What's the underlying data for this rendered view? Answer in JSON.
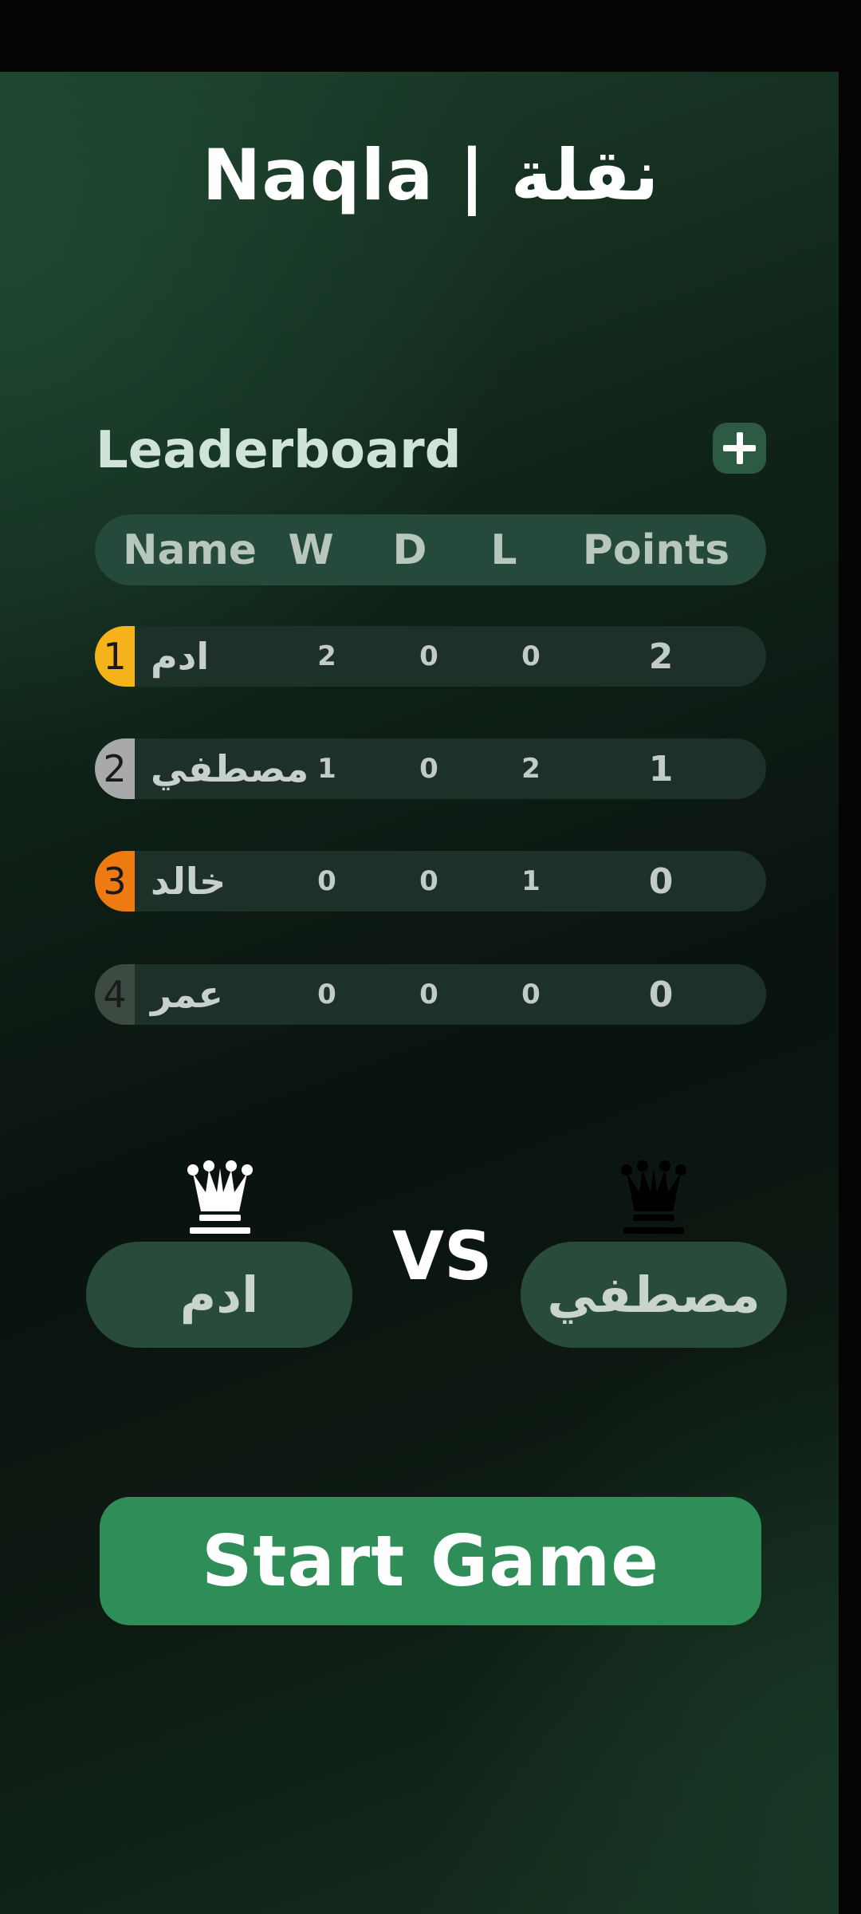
{
  "app": {
    "title": "Naqla | نقلة"
  },
  "leaderboard": {
    "heading": "Leaderboard",
    "add_icon": "plus-icon",
    "columns": {
      "name": "Name",
      "w": "W",
      "d": "D",
      "l": "L",
      "points": "Points"
    },
    "rows": [
      {
        "rank": "1",
        "rank_color": "#f6b21b",
        "name": "ادم",
        "w": "2",
        "d": "0",
        "l": "0",
        "points": "2"
      },
      {
        "rank": "2",
        "rank_color": "#a7a9aa",
        "name": "مصطفي",
        "w": "1",
        "d": "0",
        "l": "2",
        "points": "1"
      },
      {
        "rank": "3",
        "rank_color": "#f07a12",
        "name": "خالد",
        "w": "0",
        "d": "0",
        "l": "1",
        "points": "0"
      },
      {
        "rank": "4",
        "rank_color": "#3c4a42",
        "name": "عمر",
        "w": "0",
        "d": "0",
        "l": "0",
        "points": "0"
      }
    ]
  },
  "match": {
    "white_player": "ادم",
    "white_icon": "white-queen-icon",
    "black_player": "مصطفي",
    "black_icon": "black-queen-icon",
    "vs_label": "VS"
  },
  "start_button": {
    "label": "Start Game"
  },
  "colors": {
    "accent": "#2f8d57",
    "panel": "#25493a",
    "row_bg": "#1e3128"
  }
}
